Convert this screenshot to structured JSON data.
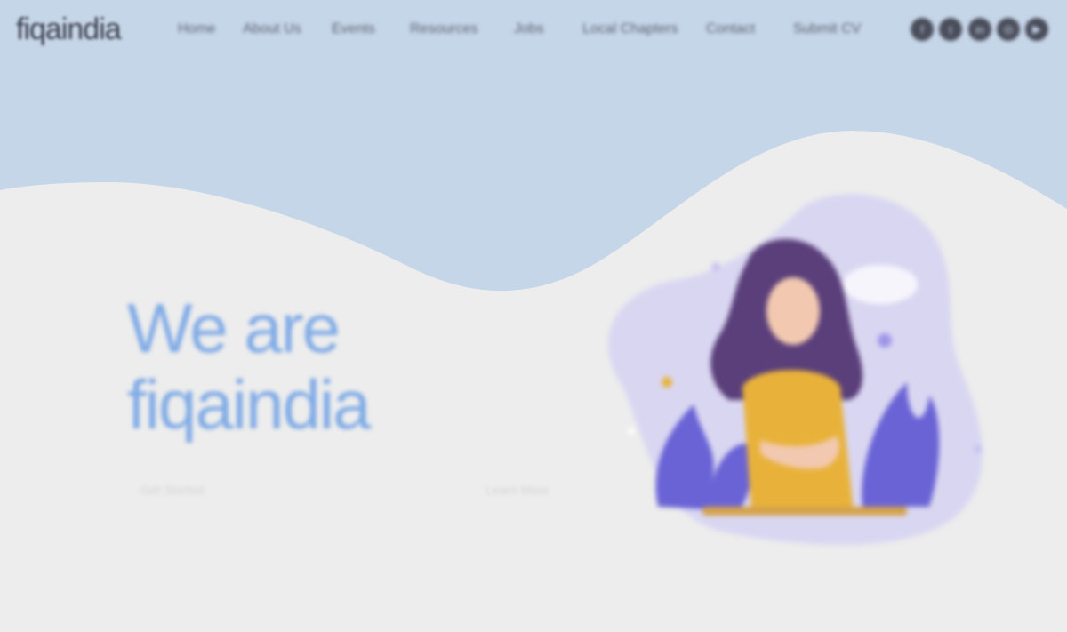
{
  "brand": {
    "logo_text": "fiqaindia"
  },
  "nav": {
    "items": [
      {
        "label": "Home"
      },
      {
        "label": "About Us"
      },
      {
        "label": "Events"
      },
      {
        "label": "Resources"
      },
      {
        "label": "Jobs"
      },
      {
        "label": "Local Chapters"
      },
      {
        "label": "Contact"
      },
      {
        "label": "Submit CV"
      }
    ]
  },
  "social": [
    {
      "icon": "facebook-icon",
      "glyph": "f"
    },
    {
      "icon": "twitter-icon",
      "glyph": "t"
    },
    {
      "icon": "linkedin-icon",
      "glyph": "in"
    },
    {
      "icon": "instagram-icon",
      "glyph": "◎"
    },
    {
      "icon": "youtube-icon",
      "glyph": "▶"
    }
  ],
  "hero": {
    "title_line1": "We are",
    "title_line2": "fiqaindia",
    "cta_primary": "Get Started",
    "cta_secondary": "Learn More"
  },
  "colors": {
    "header_bg": "#c6d6e9",
    "page_bg": "#ededed",
    "accent": "#80abe6",
    "illustration_blob": "#d9d6f1",
    "shirt": "#e8b23a",
    "hair": "#5a3f7a",
    "leaves": "#6a63d6"
  }
}
